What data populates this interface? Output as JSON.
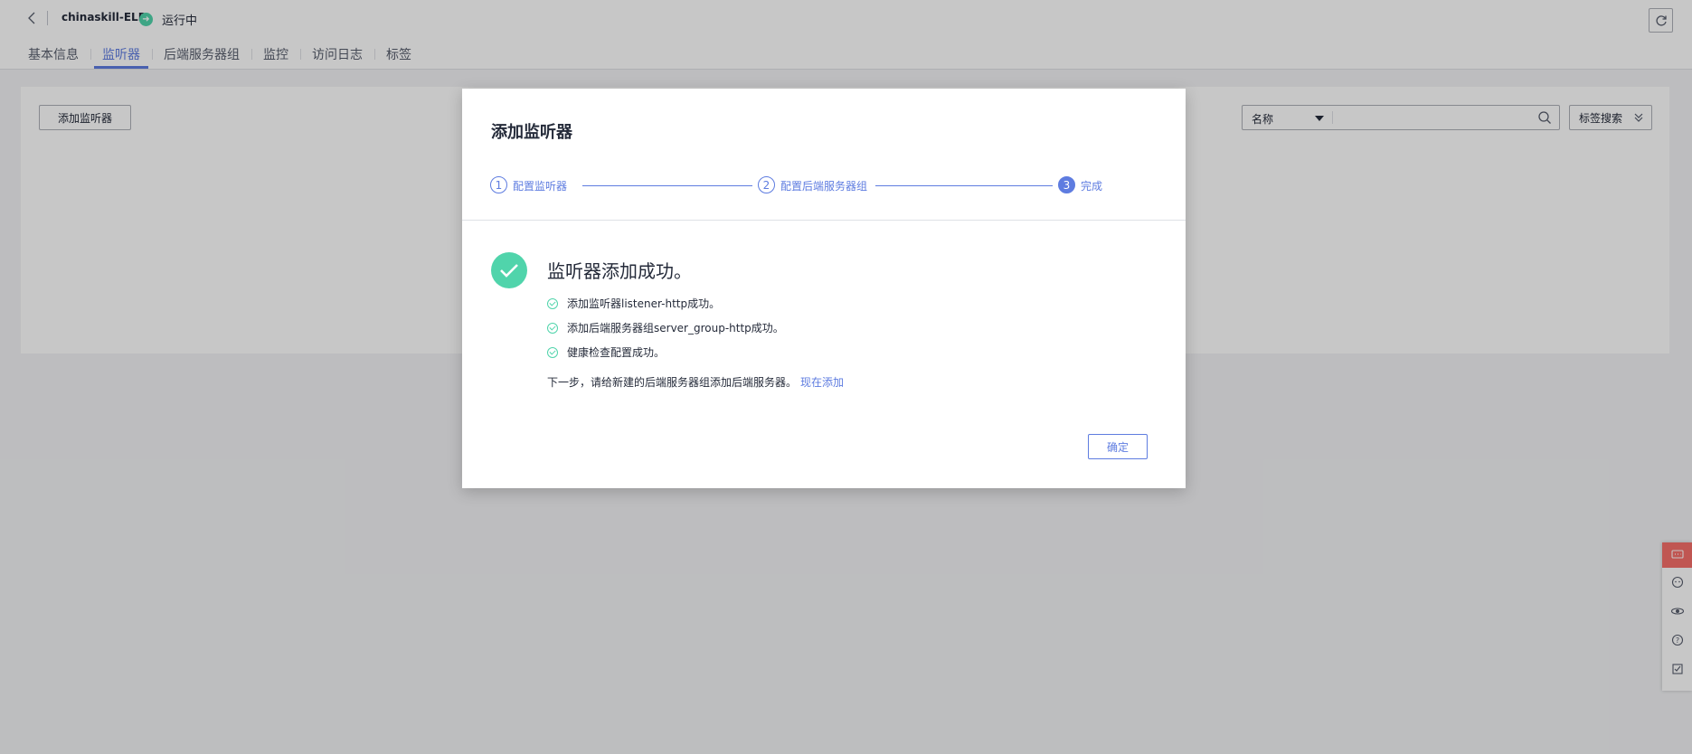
{
  "header": {
    "title": "chinaskill-ELB",
    "status": "运行中",
    "tabs": [
      {
        "label": "基本信息"
      },
      {
        "label": "监听器"
      },
      {
        "label": "后端服务器组"
      },
      {
        "label": "监控"
      },
      {
        "label": "访问日志"
      },
      {
        "label": "标签"
      }
    ]
  },
  "toolbar": {
    "add_label": "添加监听器",
    "search_field": "名称",
    "search_placeholder": "",
    "tag_search": "标签搜索"
  },
  "modal": {
    "title": "添加监听器",
    "steps": [
      {
        "num": "1",
        "label": "配置监听器"
      },
      {
        "num": "2",
        "label": "配置后端服务器组"
      },
      {
        "num": "3",
        "label": "完成"
      }
    ],
    "success_title": "监听器添加成功。",
    "messages": [
      "添加监听器listener-http成功。",
      "添加后端服务器组server_group-http成功。",
      "健康检查配置成功。"
    ],
    "next_text": "下一步，请给新建的后端服务器组添加后端服务器。",
    "next_link": "现在添加",
    "ok_label": "确定"
  },
  "colors": {
    "accent": "#5e7ce0",
    "success": "#50d4ab",
    "feedback": "#f66f6a"
  }
}
